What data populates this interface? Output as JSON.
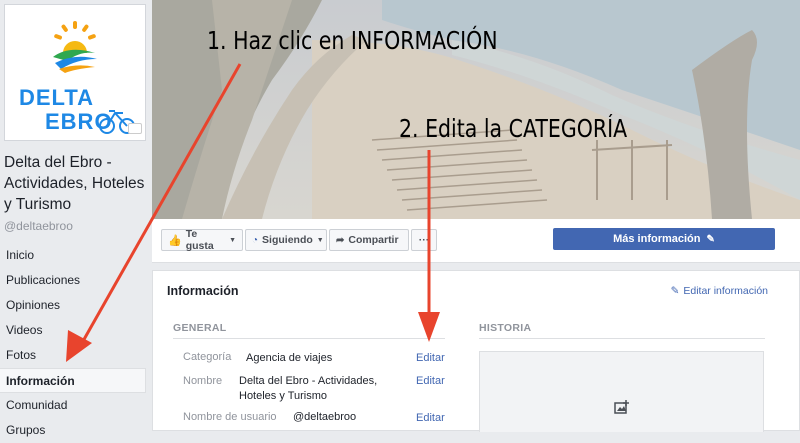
{
  "page": {
    "logo_line1": "DELTA",
    "logo_line2": "EBRO",
    "name": "Delta del Ebro - Actividades, Hoteles y Turismo",
    "handle": "@deltaebroo"
  },
  "nav": {
    "items": [
      {
        "label": "Inicio"
      },
      {
        "label": "Publicaciones"
      },
      {
        "label": "Opiniones"
      },
      {
        "label": "Videos"
      },
      {
        "label": "Fotos"
      },
      {
        "label": "Información"
      },
      {
        "label": "Comunidad"
      },
      {
        "label": "Grupos"
      }
    ],
    "active": "Información"
  },
  "actions": {
    "like": "Te gusta",
    "following": "Siguiendo",
    "share": "Compartir",
    "more": "···",
    "more_info": "Más información"
  },
  "info_panel": {
    "title": "Información",
    "edit_info": "Editar información",
    "general": "GENERAL",
    "history": "HISTORIA",
    "rows": [
      {
        "label": "Categoría",
        "value": "Agencia de viajes",
        "edit": "Editar"
      },
      {
        "label": "Nombre",
        "value_line1": "Delta del Ebro - Actividades,",
        "value_line2": "Hoteles y Turismo",
        "edit": "Editar"
      },
      {
        "label": "Nombre de usuario",
        "value": "@deltaebroo",
        "edit": "Editar"
      }
    ]
  },
  "annotations": {
    "step1": "1. Haz clic en INFORMACIÓN",
    "step2": "2. Edita la CATEGORÍA"
  },
  "colors": {
    "facebook_blue": "#4267b2",
    "arrow_red": "#e8442d",
    "background": "#e9ebee"
  }
}
